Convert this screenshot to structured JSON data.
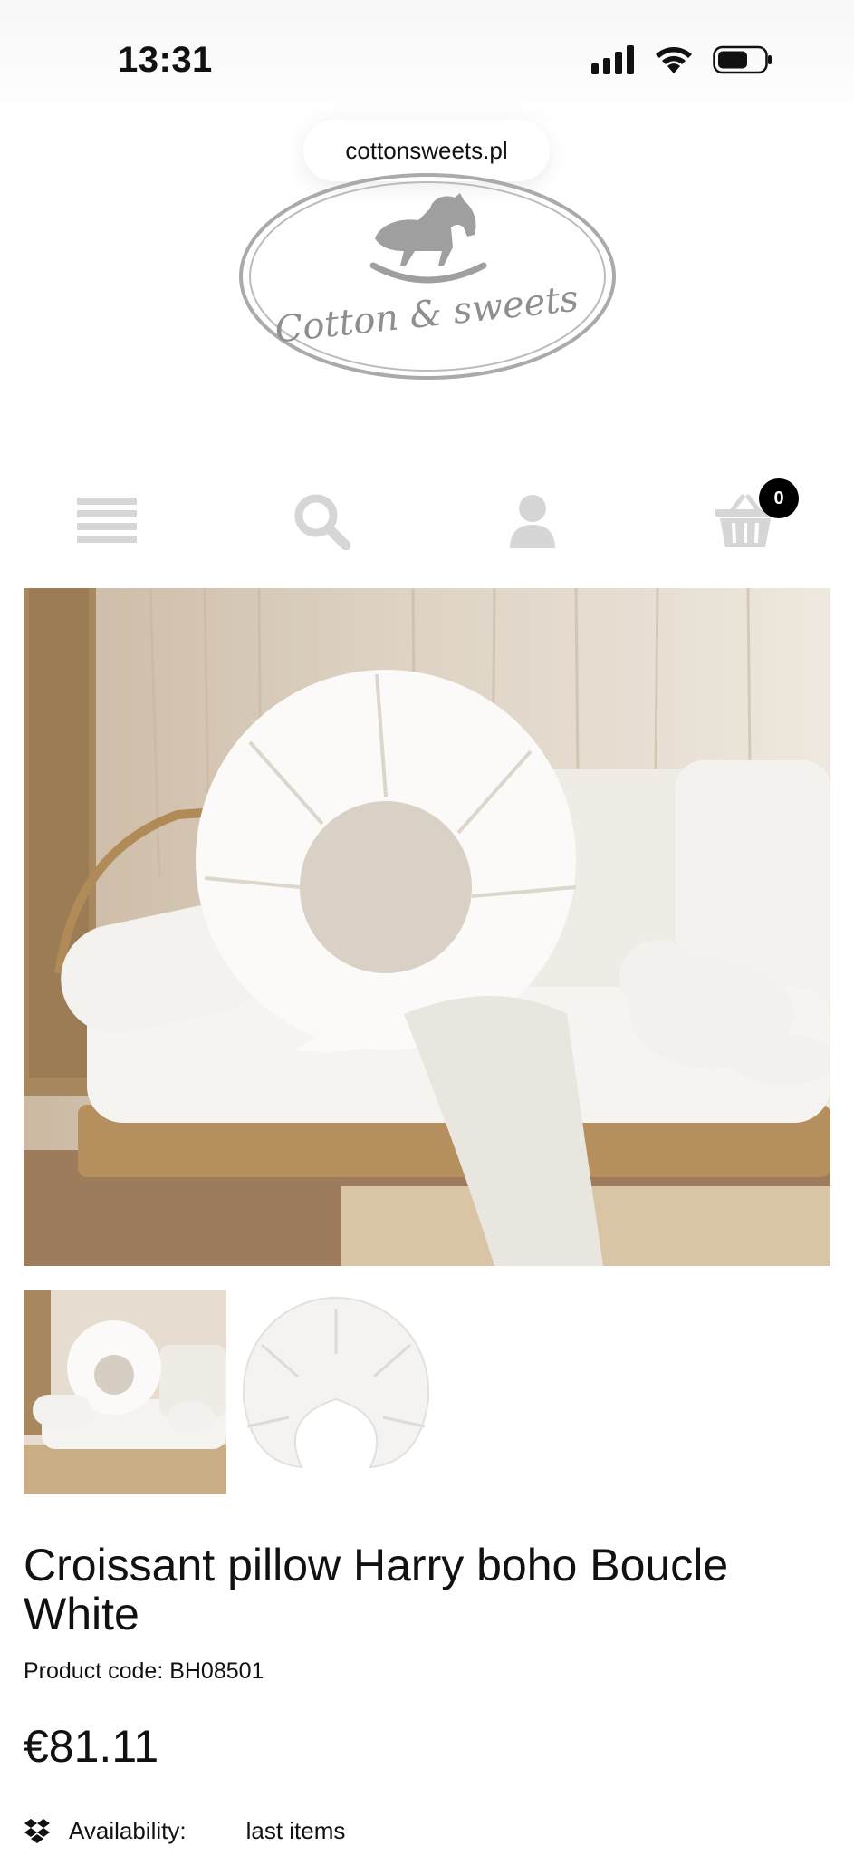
{
  "status_bar": {
    "time": "13:31",
    "icons": [
      "signal-icon",
      "wifi-icon",
      "battery-icon"
    ]
  },
  "browser": {
    "url": "cottonsweets.pl"
  },
  "logo": {
    "text": "Cotton & sweets",
    "icon": "rocking-horse-icon"
  },
  "nav": {
    "icons": [
      "menu-icon",
      "search-icon",
      "user-icon",
      "basket-icon"
    ],
    "cart_count": "0"
  },
  "product": {
    "title": "Croissant pillow Harry boho Boucle White",
    "code": "Product code: BH08501",
    "price": "€81.11",
    "availability_label": "Availability:",
    "availability_value": "last items"
  },
  "colors": {
    "icon_gray": "#d6d6d6",
    "logo_gray": "#a9a9a9",
    "badge": "#000000"
  }
}
